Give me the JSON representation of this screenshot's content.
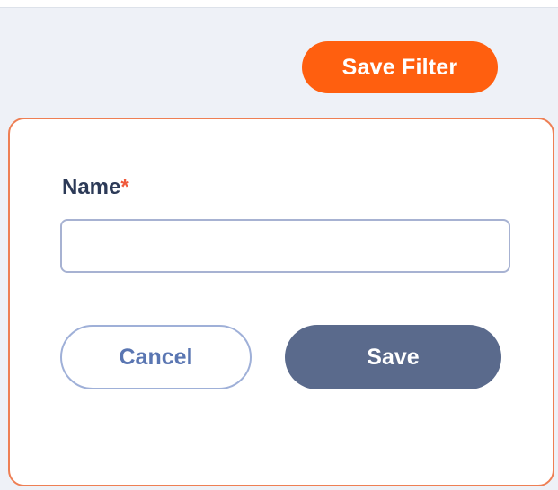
{
  "toolbar": {
    "save_filter_label": "Save Filter"
  },
  "modal": {
    "name_label": "Name",
    "required_mark": "*",
    "name_input": {
      "value": "",
      "placeholder": ""
    },
    "cancel_label": "Cancel",
    "save_label": "Save"
  },
  "colors": {
    "accent_orange": "#ff5f0f",
    "modal_border": "#ee7f54",
    "save_button": "#5a6a8c",
    "cancel_text": "#5a76b2",
    "required": "#f05a3c",
    "label_text": "#2c3a57"
  }
}
